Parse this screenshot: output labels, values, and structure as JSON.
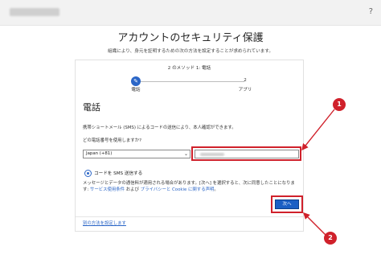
{
  "topbar": {
    "help_label": "?"
  },
  "page": {
    "title": "アカウントのセキュリティ保護",
    "subtitle": "組織により、身元を証明するための次の方法を設定することが求められています。"
  },
  "progress": {
    "method_step": "2 のメソッド 1: 電話",
    "step1_label": "電話",
    "step2_number": "2",
    "step2_label": "アプリ"
  },
  "phone_section": {
    "title": "電話",
    "description": "携帯ショートメール (SMS) によるコードの送信により、本人確認ができます。",
    "question": "どの電話番号を使用しますか?",
    "country_value": "Japan (+81)",
    "radio_label": "コードを SMS 送信する",
    "terms_prefix": "メッセージとデータの通信料が適用される場合があります。[次へ] を選択すると、次に同意したことになります: ",
    "terms_link1": "サービス使用条件",
    "terms_and": " および ",
    "terms_link2": "プライバシーと Cookie に関する声明",
    "terms_suffix": "。",
    "next_label": "次へ",
    "alt_method_link": "別の方法を設定します"
  },
  "callouts": {
    "one": "1",
    "two": "2"
  },
  "colors": {
    "accent": "#1b5fc4",
    "annotation_red": "#d0212b"
  }
}
